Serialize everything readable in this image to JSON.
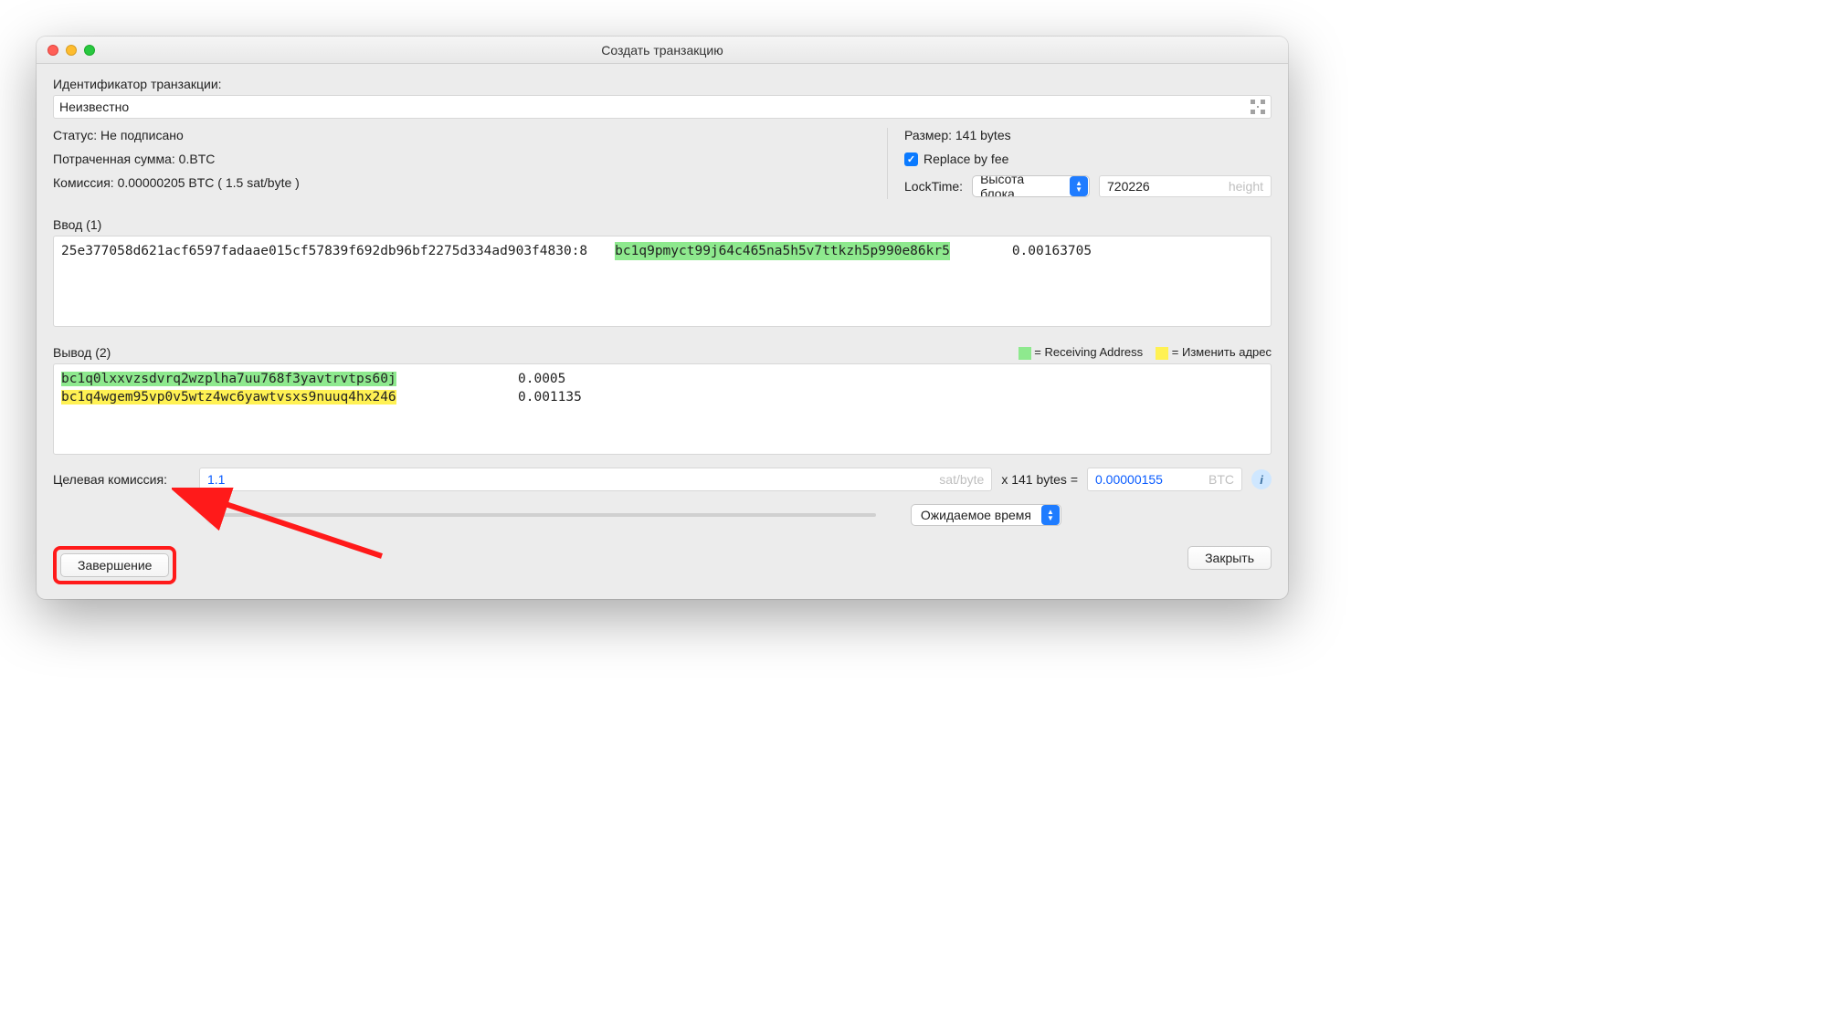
{
  "window_title": "Создать транзакцию",
  "txid_label": "Идентификатор транзакции:",
  "txid_value": "Неизвестно",
  "status_line": "Статус: Не подписано",
  "amount_spent_line": "Потраченная сумма: 0.BTC",
  "commission_line": "Комиссия: 0.00000205 BTC  ( 1.5 sat/byte )",
  "size_line": "Размер: 141 bytes",
  "rbf_label": "Replace by fee",
  "locktime_label": "LockTime:",
  "locktime_select": "Высота блока",
  "locktime_value": "720226",
  "locktime_placeholder": "height",
  "inputs_header": "Ввод (1)",
  "inputs": [
    {
      "txid": "25e377058d621acf6597fadaae015cf57839f692db96bf2275d334ad903f4830:8",
      "address": "bc1q9pmyct99j64c465na5h5v7ttkzh5p990e86kr5",
      "amount": "0.00163705"
    }
  ],
  "outputs_header": "Вывод (2)",
  "legend_receiving": "= Receiving Address",
  "legend_change": "= Изменить адрес",
  "outputs": [
    {
      "address": "bc1q0lxxvzsdvrq2wzplha7uu768f3yavtrvtps60j",
      "amount": "0.0005",
      "kind": "receiving"
    },
    {
      "address": "bc1q4wgem95vp0v5wtz4wc6yawtvsxs9nuuq4hx246",
      "amount": "0.001135",
      "kind": "change"
    }
  ],
  "target_fee_label": "Целевая комиссия:",
  "target_fee_value": "1.1",
  "satbyte_unit": "sat/byte",
  "multiply_text": "x   141 bytes   =",
  "btc_fee_value": "0.00000155",
  "btc_unit": "BTC",
  "eta_label": "Ожидаемое время",
  "finish_button": "Завершение",
  "close_button": "Закрыть"
}
